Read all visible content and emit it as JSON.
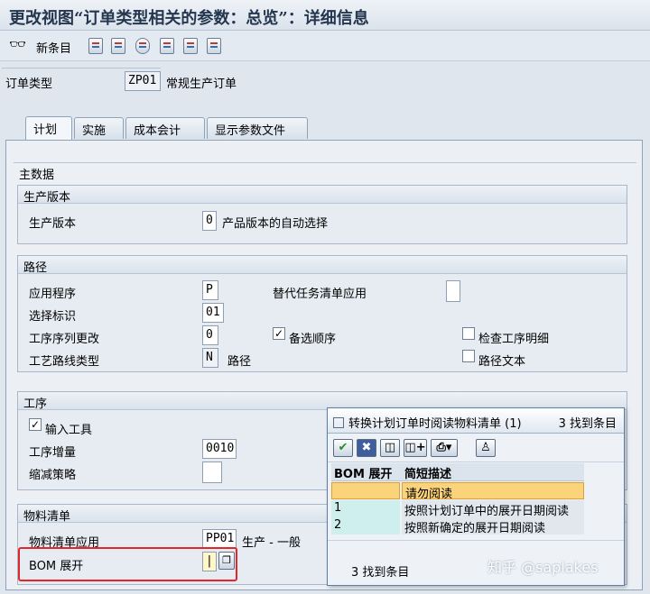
{
  "window": {
    "title": "更改视图“订单类型相关的参数：总览”：详细信息"
  },
  "toolbar": {
    "new_entries": "新条目",
    "icons": [
      "copy-icon",
      "delete-icon",
      "undo-icon",
      "select-all-icon",
      "deselect-icon",
      "print-icon"
    ]
  },
  "header": {
    "order_type_label": "订单类型",
    "order_type_value": "ZP01",
    "order_type_desc": "常规生产订单"
  },
  "tabs": [
    "计划",
    "实施",
    "成本会计",
    "显示参数文件"
  ],
  "master_data": {
    "title": "主数据",
    "production_version": {
      "title": "生产版本",
      "label": "生产版本",
      "value": "0",
      "desc": "产品版本的自动选择"
    },
    "routing": {
      "title": "路径",
      "application_label": "应用程序",
      "application_value": "P",
      "selection_id_label": "选择标识",
      "selection_id_value": "01",
      "seq_change_label": "工序序列更改",
      "seq_change_value": "0",
      "routing_type_label": "工艺路线类型",
      "routing_type_value": "N",
      "routing_type_desc": "路径",
      "alt_task_list_label": "替代任务清单应用",
      "alt_sequence_label": "备选顺序",
      "alt_sequence_checked": true,
      "check_op_detail_label": "检查工序明细",
      "check_op_detail_checked": false,
      "routing_text_label": "路径文本",
      "routing_text_checked": false
    },
    "operations": {
      "title": "工序",
      "input_tools_label": "输入工具",
      "input_tools_checked": true,
      "increment_label": "工序增量",
      "increment_value": "0010",
      "reduction_label": "缩减策略",
      "reduction_value": ""
    },
    "bom": {
      "title": "物料清单",
      "application_label": "物料清单应用",
      "application_value": "PP01",
      "application_desc": "生产 - 一般",
      "explosion_label": "BOM 展开",
      "explosion_value": "|"
    }
  },
  "popup": {
    "title": "转换计划订单时阅读物料清单 (1)",
    "found_top": "3 找到条目",
    "columns": [
      "BOM 展开",
      "简短描述"
    ],
    "rows": [
      {
        "key": "",
        "desc": "请勿阅读"
      },
      {
        "key": "1",
        "desc": "按照计划订单中的展开日期阅读"
      },
      {
        "key": "2",
        "desc": "按照新确定的展开日期阅读"
      }
    ],
    "found_bottom": "3 找到条目"
  },
  "watermark": "知乎 @saplakes"
}
